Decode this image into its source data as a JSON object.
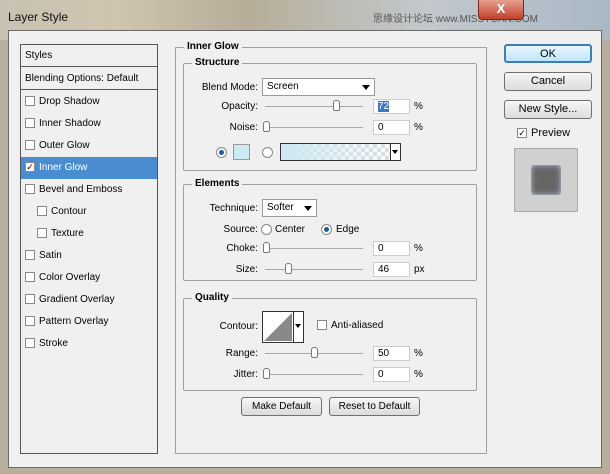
{
  "window": {
    "title": "Layer Style",
    "watermark": "思缘设计论坛 www.MISSYUAN.COM",
    "close": "X"
  },
  "styles_panel": {
    "header": "Styles",
    "blending": "Blending Options: Default",
    "items": [
      {
        "label": "Drop Shadow",
        "checked": false,
        "indent": false
      },
      {
        "label": "Inner Shadow",
        "checked": false,
        "indent": false
      },
      {
        "label": "Outer Glow",
        "checked": false,
        "indent": false
      },
      {
        "label": "Inner Glow",
        "checked": true,
        "indent": false,
        "selected": true
      },
      {
        "label": "Bevel and Emboss",
        "checked": false,
        "indent": false
      },
      {
        "label": "Contour",
        "checked": false,
        "indent": true
      },
      {
        "label": "Texture",
        "checked": false,
        "indent": true
      },
      {
        "label": "Satin",
        "checked": false,
        "indent": false
      },
      {
        "label": "Color Overlay",
        "checked": false,
        "indent": false
      },
      {
        "label": "Gradient Overlay",
        "checked": false,
        "indent": false
      },
      {
        "label": "Pattern Overlay",
        "checked": false,
        "indent": false
      },
      {
        "label": "Stroke",
        "checked": false,
        "indent": false
      }
    ]
  },
  "inner_glow": {
    "title": "Inner Glow",
    "structure": {
      "title": "Structure",
      "blend_label": "Blend Mode:",
      "blend_value": "Screen",
      "opacity_label": "Opacity:",
      "opacity": "72",
      "noise_label": "Noise:",
      "noise": "0",
      "pct": "%",
      "glow_color": "#cde9f2"
    },
    "elements": {
      "title": "Elements",
      "technique_label": "Technique:",
      "technique": "Softer",
      "source_label": "Source:",
      "center": "Center",
      "edge": "Edge",
      "choke_label": "Choke:",
      "choke": "0",
      "size_label": "Size:",
      "size": "46",
      "pct": "%",
      "px": "px"
    },
    "quality": {
      "title": "Quality",
      "contour_label": "Contour:",
      "anti_aliased": "Anti-aliased",
      "range_label": "Range:",
      "range": "50",
      "jitter_label": "Jitter:",
      "jitter": "0",
      "pct": "%"
    },
    "make_default": "Make Default",
    "reset_default": "Reset to Default"
  },
  "buttons": {
    "ok": "OK",
    "cancel": "Cancel",
    "new_style": "New Style...",
    "preview": "Preview"
  }
}
